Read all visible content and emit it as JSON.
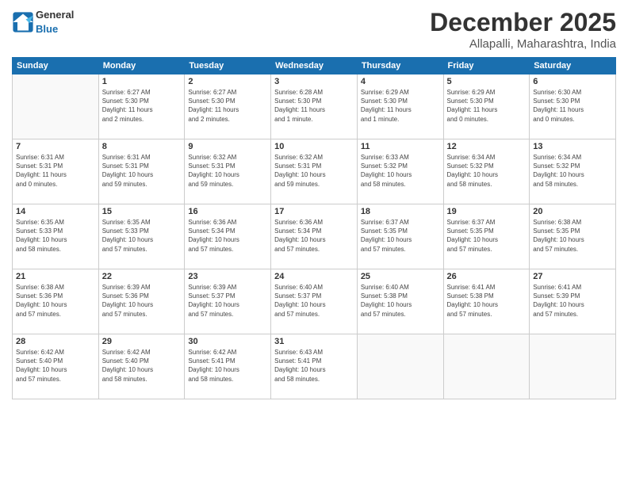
{
  "logo": {
    "text_general": "General",
    "text_blue": "Blue"
  },
  "title": "December 2025",
  "subtitle": "Allapalli, Maharashtra, India",
  "header": {
    "days": [
      "Sunday",
      "Monday",
      "Tuesday",
      "Wednesday",
      "Thursday",
      "Friday",
      "Saturday"
    ]
  },
  "weeks": [
    [
      {
        "day": "",
        "info": ""
      },
      {
        "day": "1",
        "info": "Sunrise: 6:27 AM\nSunset: 5:30 PM\nDaylight: 11 hours\nand 2 minutes."
      },
      {
        "day": "2",
        "info": "Sunrise: 6:27 AM\nSunset: 5:30 PM\nDaylight: 11 hours\nand 2 minutes."
      },
      {
        "day": "3",
        "info": "Sunrise: 6:28 AM\nSunset: 5:30 PM\nDaylight: 11 hours\nand 1 minute."
      },
      {
        "day": "4",
        "info": "Sunrise: 6:29 AM\nSunset: 5:30 PM\nDaylight: 11 hours\nand 1 minute."
      },
      {
        "day": "5",
        "info": "Sunrise: 6:29 AM\nSunset: 5:30 PM\nDaylight: 11 hours\nand 0 minutes."
      },
      {
        "day": "6",
        "info": "Sunrise: 6:30 AM\nSunset: 5:30 PM\nDaylight: 11 hours\nand 0 minutes."
      }
    ],
    [
      {
        "day": "7",
        "info": "Sunrise: 6:31 AM\nSunset: 5:31 PM\nDaylight: 11 hours\nand 0 minutes."
      },
      {
        "day": "8",
        "info": "Sunrise: 6:31 AM\nSunset: 5:31 PM\nDaylight: 10 hours\nand 59 minutes."
      },
      {
        "day": "9",
        "info": "Sunrise: 6:32 AM\nSunset: 5:31 PM\nDaylight: 10 hours\nand 59 minutes."
      },
      {
        "day": "10",
        "info": "Sunrise: 6:32 AM\nSunset: 5:31 PM\nDaylight: 10 hours\nand 59 minutes."
      },
      {
        "day": "11",
        "info": "Sunrise: 6:33 AM\nSunset: 5:32 PM\nDaylight: 10 hours\nand 58 minutes."
      },
      {
        "day": "12",
        "info": "Sunrise: 6:34 AM\nSunset: 5:32 PM\nDaylight: 10 hours\nand 58 minutes."
      },
      {
        "day": "13",
        "info": "Sunrise: 6:34 AM\nSunset: 5:32 PM\nDaylight: 10 hours\nand 58 minutes."
      }
    ],
    [
      {
        "day": "14",
        "info": "Sunrise: 6:35 AM\nSunset: 5:33 PM\nDaylight: 10 hours\nand 58 minutes."
      },
      {
        "day": "15",
        "info": "Sunrise: 6:35 AM\nSunset: 5:33 PM\nDaylight: 10 hours\nand 57 minutes."
      },
      {
        "day": "16",
        "info": "Sunrise: 6:36 AM\nSunset: 5:34 PM\nDaylight: 10 hours\nand 57 minutes."
      },
      {
        "day": "17",
        "info": "Sunrise: 6:36 AM\nSunset: 5:34 PM\nDaylight: 10 hours\nand 57 minutes."
      },
      {
        "day": "18",
        "info": "Sunrise: 6:37 AM\nSunset: 5:35 PM\nDaylight: 10 hours\nand 57 minutes."
      },
      {
        "day": "19",
        "info": "Sunrise: 6:37 AM\nSunset: 5:35 PM\nDaylight: 10 hours\nand 57 minutes."
      },
      {
        "day": "20",
        "info": "Sunrise: 6:38 AM\nSunset: 5:35 PM\nDaylight: 10 hours\nand 57 minutes."
      }
    ],
    [
      {
        "day": "21",
        "info": "Sunrise: 6:38 AM\nSunset: 5:36 PM\nDaylight: 10 hours\nand 57 minutes."
      },
      {
        "day": "22",
        "info": "Sunrise: 6:39 AM\nSunset: 5:36 PM\nDaylight: 10 hours\nand 57 minutes."
      },
      {
        "day": "23",
        "info": "Sunrise: 6:39 AM\nSunset: 5:37 PM\nDaylight: 10 hours\nand 57 minutes."
      },
      {
        "day": "24",
        "info": "Sunrise: 6:40 AM\nSunset: 5:37 PM\nDaylight: 10 hours\nand 57 minutes."
      },
      {
        "day": "25",
        "info": "Sunrise: 6:40 AM\nSunset: 5:38 PM\nDaylight: 10 hours\nand 57 minutes."
      },
      {
        "day": "26",
        "info": "Sunrise: 6:41 AM\nSunset: 5:38 PM\nDaylight: 10 hours\nand 57 minutes."
      },
      {
        "day": "27",
        "info": "Sunrise: 6:41 AM\nSunset: 5:39 PM\nDaylight: 10 hours\nand 57 minutes."
      }
    ],
    [
      {
        "day": "28",
        "info": "Sunrise: 6:42 AM\nSunset: 5:40 PM\nDaylight: 10 hours\nand 57 minutes."
      },
      {
        "day": "29",
        "info": "Sunrise: 6:42 AM\nSunset: 5:40 PM\nDaylight: 10 hours\nand 58 minutes."
      },
      {
        "day": "30",
        "info": "Sunrise: 6:42 AM\nSunset: 5:41 PM\nDaylight: 10 hours\nand 58 minutes."
      },
      {
        "day": "31",
        "info": "Sunrise: 6:43 AM\nSunset: 5:41 PM\nDaylight: 10 hours\nand 58 minutes."
      },
      {
        "day": "",
        "info": ""
      },
      {
        "day": "",
        "info": ""
      },
      {
        "day": "",
        "info": ""
      }
    ]
  ]
}
